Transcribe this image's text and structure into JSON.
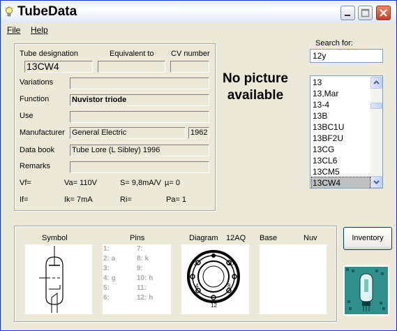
{
  "app": {
    "title": "TubeData"
  },
  "menu": {
    "file_label": "File",
    "help_label": "Help"
  },
  "details": {
    "designation_label": "Tube designation",
    "designation_value": "13CW4",
    "equivalent_label": "Equivalent to",
    "equivalent_value": "",
    "cv_label": "CV number",
    "cv_value": "",
    "variations_label": "Variations",
    "variations_value": "",
    "function_label": "Function",
    "function_value": "Nuvistor triode",
    "use_label": "Use",
    "use_value": "",
    "manufacturer_label": "Manufacturer",
    "manufacturer_value": "General Electric",
    "year_value": "1962",
    "databook_label": "Data book",
    "databook_value": "Tube Lore (L Sibley) 1996",
    "remarks_label": "Remarks",
    "remarks_value": "",
    "params_row1": [
      "Vf=",
      "Va=  110V",
      "S=  9,8mA/V",
      "µ=    0"
    ],
    "params_row2": [
      "If=",
      "Ik=   7mA",
      "Ri=",
      "Pa= 1"
    ]
  },
  "picture": {
    "no_picture_text": "No picture available"
  },
  "search": {
    "label": "Search for:",
    "value": "12y",
    "results": [
      "13",
      "13,Mar",
      "13-4",
      "13B",
      "13BC1U",
      "13BF2U",
      "13CG",
      "13CL6",
      "13CM5",
      "13CW4"
    ],
    "selected": "13CW4"
  },
  "bottom": {
    "symbol_label": "Symbol",
    "pins_label": "Pins",
    "diagram_label": "Diagram",
    "diagram_code": "12AQ",
    "base_label": "Base",
    "base_value": "Nuv",
    "pins_left": [
      "1:",
      "2: a",
      "3:",
      "4: g",
      "5:",
      "6:"
    ],
    "pins_right": [
      "7:",
      "8: k",
      "9:",
      "10: h",
      "11:",
      "12: h"
    ]
  },
  "inventory_button": "Inventory",
  "colors": {
    "titlebar_text": "#000000",
    "selection": "#c0c0c0",
    "pin_text": "#a8a8a8"
  }
}
